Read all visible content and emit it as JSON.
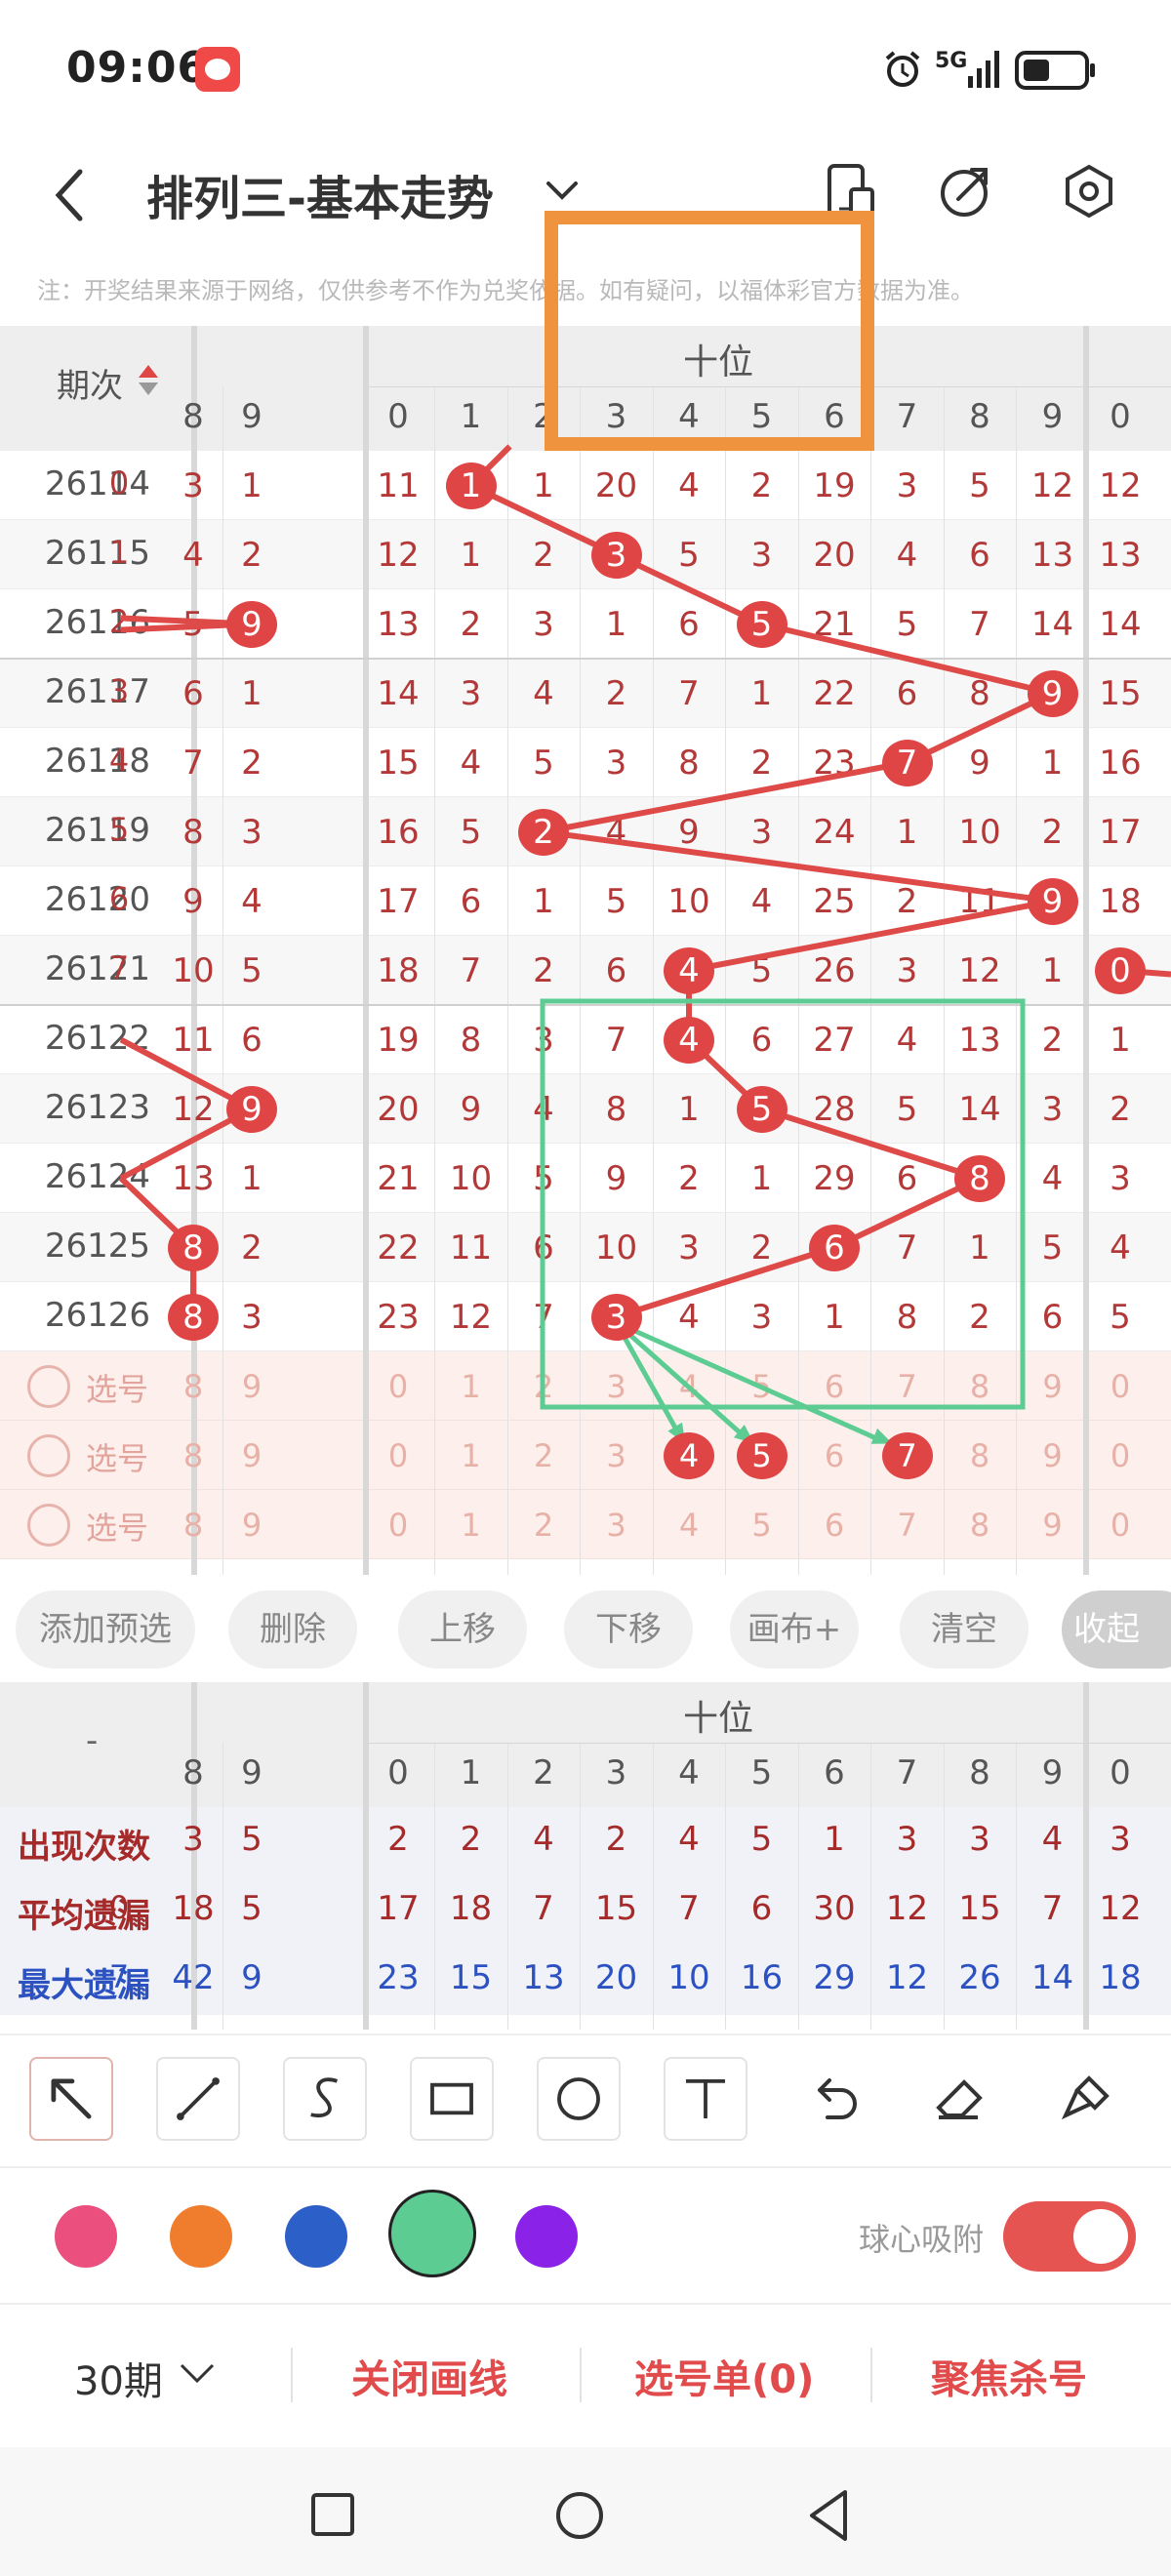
{
  "status_bar": {
    "time": "09:06",
    "network": "5G",
    "icons": [
      "app-notification-icon",
      "alarm-icon",
      "signal-icon",
      "battery-icon"
    ]
  },
  "header": {
    "title": "排列三-基本走势",
    "icons": [
      "back-icon",
      "dropdown-icon",
      "phone-layout-icon",
      "share-icon",
      "settings-icon"
    ]
  },
  "notice": "注：开奖结果来源于网络，仅供参考不作为兑奖依据。如有疑问，以福体彩官方数据为准。",
  "table": {
    "period_header": "期次",
    "group_title": "十位",
    "left_cols": [
      "8",
      "9"
    ],
    "digit_cols": [
      "0",
      "1",
      "2",
      "3",
      "4",
      "5",
      "6",
      "7",
      "8",
      "9"
    ],
    "next_col": "0",
    "rows": [
      {
        "period": "26114",
        "edge": "0",
        "left": [
          "3",
          "1"
        ],
        "digits": [
          "11",
          "1",
          "1",
          "20",
          "4",
          "2",
          "19",
          "3",
          "5",
          "12"
        ],
        "next": "12",
        "hit": 1
      },
      {
        "period": "26115",
        "edge": "1",
        "left": [
          "4",
          "2"
        ],
        "digits": [
          "12",
          "1",
          "2",
          "3",
          "5",
          "3",
          "20",
          "4",
          "6",
          "13"
        ],
        "next": "13",
        "hit": 3
      },
      {
        "period": "26116",
        "edge": "2",
        "left": [
          "5",
          "9"
        ],
        "digits": [
          "13",
          "2",
          "3",
          "1",
          "6",
          "5",
          "21",
          "5",
          "7",
          "14"
        ],
        "next": "14",
        "hit": 5,
        "left_hit": 1
      },
      {
        "period": "26117",
        "edge": "3",
        "left": [
          "6",
          "1"
        ],
        "digits": [
          "14",
          "3",
          "4",
          "2",
          "7",
          "1",
          "22",
          "6",
          "8",
          "9"
        ],
        "next": "15",
        "hit": 9
      },
      {
        "period": "26118",
        "edge": "4",
        "left": [
          "7",
          "2"
        ],
        "digits": [
          "15",
          "4",
          "5",
          "3",
          "8",
          "2",
          "23",
          "7",
          "9",
          "1"
        ],
        "next": "16",
        "hit": 7
      },
      {
        "period": "26119",
        "edge": "5",
        "left": [
          "8",
          "3"
        ],
        "digits": [
          "16",
          "5",
          "2",
          "4",
          "9",
          "3",
          "24",
          "1",
          "10",
          "2"
        ],
        "next": "17",
        "hit": 2
      },
      {
        "period": "26120",
        "edge": "6",
        "left": [
          "9",
          "4"
        ],
        "digits": [
          "17",
          "6",
          "1",
          "5",
          "10",
          "4",
          "25",
          "2",
          "11",
          "9"
        ],
        "next": "18",
        "hit": 9
      },
      {
        "period": "26121",
        "edge": "7",
        "left": [
          "10",
          "5"
        ],
        "digits": [
          "18",
          "7",
          "2",
          "6",
          "4",
          "5",
          "26",
          "3",
          "12",
          "1"
        ],
        "next": "0",
        "hit": 4,
        "next_hit": true
      },
      {
        "period": "26122",
        "edge": "",
        "left": [
          "11",
          "6"
        ],
        "digits": [
          "19",
          "8",
          "3",
          "7",
          "4",
          "6",
          "27",
          "4",
          "13",
          "2"
        ],
        "next": "1",
        "hit": 4
      },
      {
        "period": "26123",
        "edge": "",
        "left": [
          "12",
          "9"
        ],
        "digits": [
          "20",
          "9",
          "4",
          "8",
          "1",
          "5",
          "28",
          "5",
          "14",
          "3"
        ],
        "next": "2",
        "hit": 5,
        "left_hit": 1
      },
      {
        "period": "26124",
        "edge": "",
        "left": [
          "13",
          "1"
        ],
        "digits": [
          "21",
          "10",
          "5",
          "9",
          "2",
          "1",
          "29",
          "6",
          "8",
          "4"
        ],
        "next": "3",
        "hit": 8
      },
      {
        "period": "26125",
        "edge": "",
        "left": [
          "8",
          "2"
        ],
        "digits": [
          "22",
          "11",
          "6",
          "10",
          "3",
          "2",
          "6",
          "7",
          "1",
          "5"
        ],
        "next": "4",
        "hit": 6,
        "left_hit": 0
      },
      {
        "period": "26126",
        "edge": "",
        "left": [
          "8",
          "3"
        ],
        "digits": [
          "23",
          "12",
          "7",
          "3",
          "4",
          "3",
          "1",
          "8",
          "2",
          "6"
        ],
        "next": "5",
        "hit": 3,
        "left_hit": 0
      }
    ],
    "select_rows": [
      {
        "label": "选号",
        "values": [
          "8",
          "9",
          "0",
          "1",
          "2",
          "3",
          "4",
          "5",
          "6",
          "7",
          "8",
          "9",
          "0"
        ]
      },
      {
        "label": "选号",
        "values": [
          "8",
          "9",
          "0",
          "1",
          "2",
          "3",
          "4",
          "5",
          "6",
          "7",
          "8",
          "9",
          "0"
        ],
        "picked": [
          4,
          5,
          7
        ]
      },
      {
        "label": "选号",
        "values": [
          "8",
          "9",
          "0",
          "1",
          "2",
          "3",
          "4",
          "5",
          "6",
          "7",
          "8",
          "9",
          "0"
        ]
      }
    ]
  },
  "actions": [
    "添加预选",
    "删除",
    "上移",
    "下移",
    "画布+",
    "清空"
  ],
  "collapse_label": "收起",
  "stats": {
    "dash": "-",
    "group_title": "十位",
    "left_cols": [
      "8",
      "9"
    ],
    "digit_cols": [
      "0",
      "1",
      "2",
      "3",
      "4",
      "5",
      "6",
      "7",
      "8",
      "9"
    ],
    "next_col": "0",
    "rows": [
      {
        "label": "出现次数",
        "edge": "",
        "values": [
          "3",
          "5",
          "2",
          "2",
          "4",
          "2",
          "4",
          "5",
          "1",
          "3",
          "3",
          "4",
          "3"
        ]
      },
      {
        "label": "平均遗漏",
        "edge": "0",
        "values": [
          "18",
          "5",
          "17",
          "18",
          "7",
          "15",
          "7",
          "6",
          "30",
          "12",
          "15",
          "7",
          "12"
        ]
      },
      {
        "label": "最大遗漏",
        "edge": "7",
        "values": [
          "42",
          "9",
          "23",
          "15",
          "13",
          "20",
          "10",
          "16",
          "29",
          "12",
          "26",
          "14",
          "18"
        ]
      }
    ]
  },
  "drawing_tools": [
    "arrow-tool-icon",
    "line-tool-icon",
    "curve-tool-icon",
    "rectangle-tool-icon",
    "circle-tool-icon",
    "text-tool-icon",
    "undo-icon",
    "eraser-icon",
    "brush-icon"
  ],
  "colors": {
    "pink": "#ea4f7d",
    "orange": "#ef7d2d",
    "blue": "#2d5fc8",
    "green": "#5dcc93",
    "purple": "#8a22e8",
    "ball": "#e04545",
    "line": "#de4a48",
    "highlight_orange": "#f0933e"
  },
  "snap_label": "球心吸附",
  "snap_on": true,
  "bottom": {
    "period_select": "30期",
    "close_lines": "关闭画线",
    "pick_list": "选号单(0)",
    "focus_kill": "聚焦杀号"
  }
}
